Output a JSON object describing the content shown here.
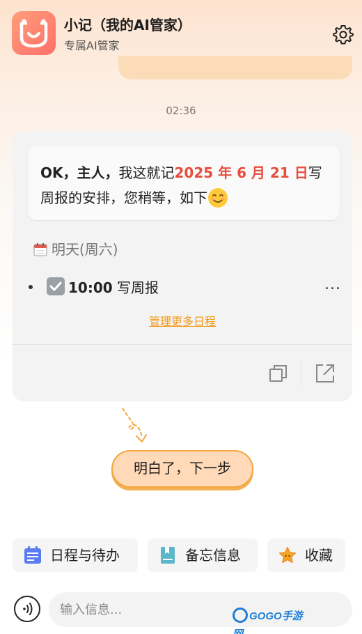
{
  "header": {
    "title": "小记（我的AI管家）",
    "subtitle": "专属AI管家",
    "logo_icon": "smile-face-logo",
    "settings_icon": "gear-icon"
  },
  "chat": {
    "timestamp": "02:36",
    "reply": {
      "greeting": "OK，主人，",
      "text_before": "我这就记",
      "date": "2025 年 6 月 21 日",
      "text_after": "写周报的安排，您稍等，如下",
      "emoji": "smiling-face-emoji",
      "date_color": "#e74c3c"
    },
    "schedule": {
      "day_label": "明天(周六)",
      "tasks": [
        {
          "time": "10:00",
          "label": "写周报",
          "done": true
        }
      ],
      "more_label": "...",
      "manage_link": "管理更多日程"
    },
    "actions": {
      "copy_icon": "copy-icon",
      "share_icon": "share-icon"
    }
  },
  "guide": {
    "next_button": "明白了，下一步",
    "accent_color": "#f2a640"
  },
  "quick_actions": [
    {
      "label": "日程与待办",
      "icon": "calendar-icon",
      "color": "#5b7cf0"
    },
    {
      "label": "备忘信息",
      "icon": "bookmark-icon",
      "color": "#5bb8c9"
    },
    {
      "label": "收藏",
      "icon": "star-icon",
      "color": "#f5a623"
    }
  ],
  "composer": {
    "placeholder": "输入信息...",
    "voice_icon": "voice-icon"
  },
  "watermark": {
    "text": "GOGO手游网"
  }
}
